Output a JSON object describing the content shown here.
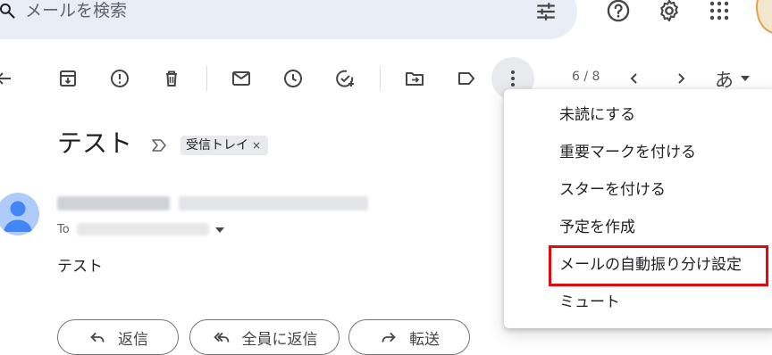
{
  "search": {
    "placeholder": "メールを検索"
  },
  "header_icons": [
    "search-icon",
    "tune-icon",
    "help-icon",
    "settings-icon",
    "apps-icon"
  ],
  "toolbar": {
    "buttons": [
      "back-icon",
      "archive-icon",
      "report-spam-icon",
      "delete-icon",
      "mark-unread-icon",
      "snooze-icon",
      "add-task-icon",
      "move-to-icon",
      "label-icon",
      "more-icon"
    ],
    "pager": "6 / 8",
    "lang_label": "あ"
  },
  "message": {
    "subject": "テスト",
    "label_chip": "受信トレイ",
    "label_remove": "×",
    "to_label": "To",
    "body": "テスト"
  },
  "actions": {
    "reply": "返信",
    "reply_all": "全員に返信",
    "forward": "転送"
  },
  "menu": {
    "items": [
      "未読にする",
      "重要マークを付ける",
      "スターを付ける",
      "予定を作成",
      "メールの自動振り分け設定",
      "ミュート"
    ],
    "highlighted_index": 4,
    "highlight_color": "#e3090f"
  },
  "colors": {
    "search_bg": "#e9eef6",
    "avatar_bg": "#aecbfa",
    "avatar_fg": "#4285f4",
    "icon": "#444746"
  }
}
